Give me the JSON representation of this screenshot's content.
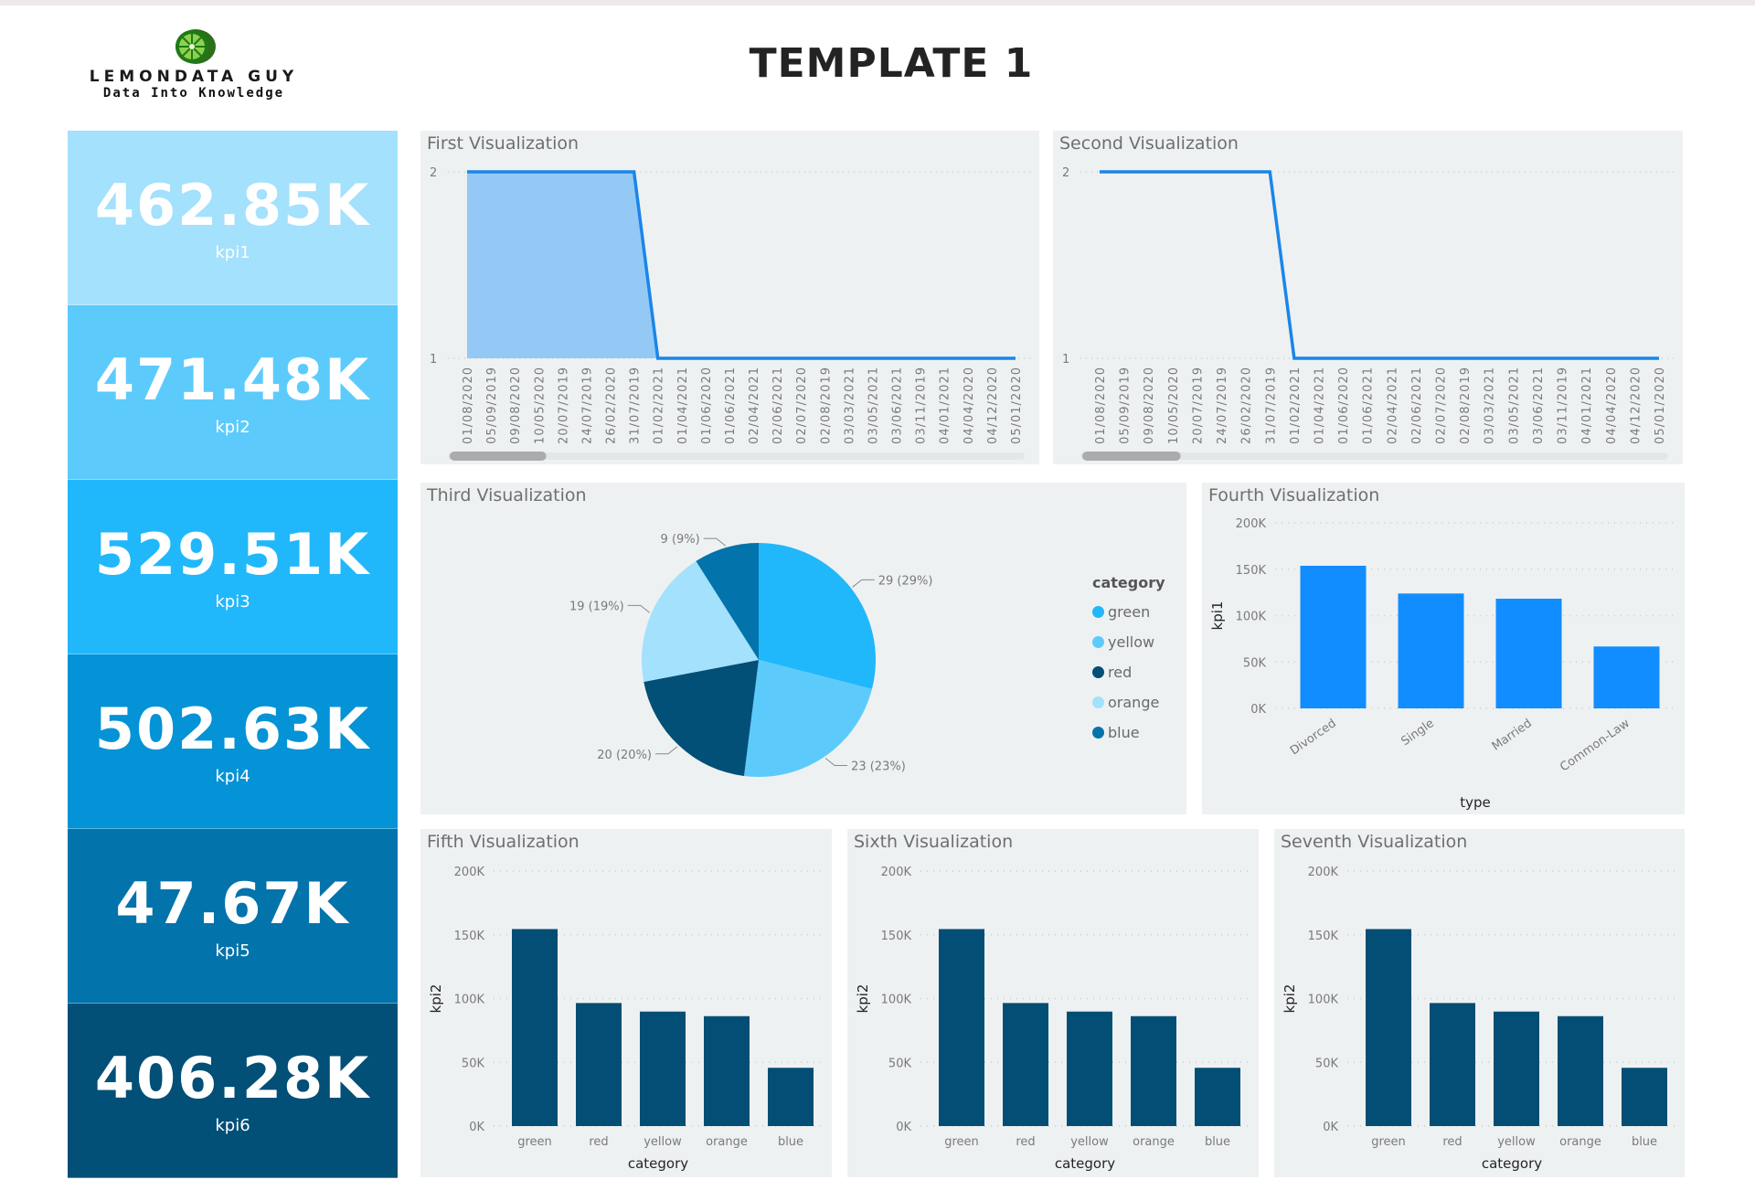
{
  "header": {
    "title": "TEMPLATE 1",
    "logo_name": "LEMONDATA GUY",
    "logo_tagline": "Data Into Knowledge",
    "logo_icon": "lime-slice-icon"
  },
  "kpis": [
    {
      "value": "462.85K",
      "label": "kpi1",
      "color": "#a3e1fc"
    },
    {
      "value": "471.48K",
      "label": "kpi2",
      "color": "#5ccbfc"
    },
    {
      "value": "529.51K",
      "label": "kpi3",
      "color": "#21b7fb"
    },
    {
      "value": "502.63K",
      "label": "kpi4",
      "color": "#0393d6"
    },
    {
      "value": "47.67K",
      "label": "kpi5",
      "color": "#0373ab"
    },
    {
      "value": "406.28K",
      "label": "kpi6",
      "color": "#024f77"
    }
  ],
  "panels": {
    "p1": "First Visualization",
    "p2": "Second Visualization",
    "p3": "Third Visualization",
    "p4": "Fourth Visualization",
    "p5": "Fifth Visualization",
    "p6": "Sixth Visualization",
    "p7": "Seventh Visualization"
  },
  "colors": {
    "panel_bg": "#eef1f2",
    "line": "#1a86e8",
    "area": "#94c9f5",
    "bar_type": "#118dff",
    "bar_category": "#034e75"
  },
  "chart_data": [
    {
      "id": "first",
      "type": "area",
      "title": "First Visualization",
      "x": [
        "01/08/2020",
        "05/09/2019",
        "09/08/2020",
        "10/05/2020",
        "20/07/2019",
        "24/07/2019",
        "26/02/2020",
        "31/07/2019",
        "01/02/2021",
        "01/04/2021",
        "01/06/2020",
        "01/06/2021",
        "02/04/2021",
        "02/06/2021",
        "02/07/2020",
        "02/08/2019",
        "03/03/2021",
        "03/05/2021",
        "03/06/2021",
        "03/11/2019",
        "04/01/2021",
        "04/04/2020",
        "04/12/2020",
        "05/01/2020"
      ],
      "values": [
        2,
        2,
        2,
        2,
        2,
        2,
        2,
        2,
        1,
        1,
        1,
        1,
        1,
        1,
        1,
        1,
        1,
        1,
        1,
        1,
        1,
        1,
        1,
        1
      ],
      "yticks": [
        1,
        2
      ],
      "ylim": [
        1,
        2
      ],
      "scrollbar_fraction": 0.27,
      "grid": true
    },
    {
      "id": "second",
      "type": "line",
      "title": "Second Visualization",
      "x": [
        "01/08/2020",
        "05/09/2019",
        "09/08/2020",
        "10/05/2020",
        "20/07/2019",
        "24/07/2019",
        "26/02/2020",
        "31/07/2019",
        "01/02/2021",
        "01/04/2021",
        "01/06/2020",
        "01/06/2021",
        "02/04/2021",
        "02/06/2021",
        "02/07/2020",
        "02/08/2019",
        "03/03/2021",
        "03/05/2021",
        "03/06/2021",
        "03/11/2019",
        "04/01/2021",
        "04/04/2020",
        "04/12/2020",
        "05/01/2020"
      ],
      "values": [
        2,
        2,
        2,
        2,
        2,
        2,
        2,
        2,
        1,
        1,
        1,
        1,
        1,
        1,
        1,
        1,
        1,
        1,
        1,
        1,
        1,
        1,
        1,
        1
      ],
      "yticks": [
        1,
        2
      ],
      "ylim": [
        1,
        2
      ],
      "scrollbar_fraction": 0.27,
      "grid": true
    },
    {
      "id": "third",
      "type": "pie",
      "title": "Third Visualization",
      "legend_title": "category",
      "legend_position": "right",
      "slices": [
        {
          "name": "green",
          "value": 29,
          "label": "29 (29%)",
          "color": "#21b7fb"
        },
        {
          "name": "yellow",
          "value": 23,
          "label": "23 (23%)",
          "color": "#5ccbfc"
        },
        {
          "name": "red",
          "value": 20,
          "label": "20 (20%)",
          "color": "#024f77"
        },
        {
          "name": "orange",
          "value": 19,
          "label": "19 (19%)",
          "color": "#a3e1fc"
        },
        {
          "name": "blue",
          "value": 9,
          "label": "9 (9%)",
          "color": "#0373ab"
        }
      ]
    },
    {
      "id": "fourth",
      "type": "bar",
      "title": "Fourth Visualization",
      "categories": [
        "Divorced",
        "Single",
        "Married",
        "Common-Law"
      ],
      "values": [
        153700,
        123800,
        118200,
        66700
      ],
      "xlabel": "type",
      "ylabel": "kpi1",
      "ylim": [
        0,
        200000
      ],
      "yticks": [
        "0K",
        "50K",
        "100K",
        "150K",
        "200K"
      ],
      "rotated_labels": true,
      "grid": true
    },
    {
      "id": "fifth",
      "type": "bar",
      "title": "Fifth Visualization",
      "categories": [
        "green",
        "red",
        "yellow",
        "orange",
        "blue"
      ],
      "values": [
        154500,
        96500,
        89800,
        86200,
        45700
      ],
      "xlabel": "category",
      "ylabel": "kpi2",
      "ylim": [
        0,
        200000
      ],
      "yticks": [
        "0K",
        "50K",
        "100K",
        "150K",
        "200K"
      ],
      "grid": true
    },
    {
      "id": "sixth",
      "type": "bar",
      "title": "Sixth Visualization",
      "categories": [
        "green",
        "red",
        "yellow",
        "orange",
        "blue"
      ],
      "values": [
        154500,
        96500,
        89800,
        86200,
        45700
      ],
      "xlabel": "category",
      "ylabel": "kpi2",
      "ylim": [
        0,
        200000
      ],
      "yticks": [
        "0K",
        "50K",
        "100K",
        "150K",
        "200K"
      ],
      "grid": true
    },
    {
      "id": "seventh",
      "type": "bar",
      "title": "Seventh Visualization",
      "categories": [
        "green",
        "red",
        "yellow",
        "orange",
        "blue"
      ],
      "values": [
        154500,
        96500,
        89800,
        86200,
        45700
      ],
      "xlabel": "category",
      "ylabel": "kpi2",
      "ylim": [
        0,
        200000
      ],
      "yticks": [
        "0K",
        "50K",
        "100K",
        "150K",
        "200K"
      ],
      "grid": true
    }
  ]
}
